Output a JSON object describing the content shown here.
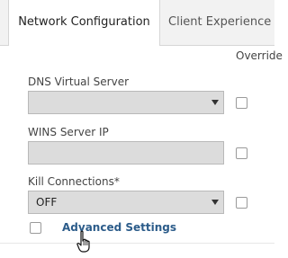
{
  "tabs": [
    {
      "label": "Network Configuration",
      "active": true
    },
    {
      "label": "Client Experience",
      "active": false
    }
  ],
  "override_header": "Override",
  "fields": {
    "dns": {
      "label": "DNS Virtual Server",
      "value": ""
    },
    "wins": {
      "label": "WINS Server IP",
      "value": ""
    },
    "kill": {
      "label": "Kill Connections*",
      "value": "OFF"
    }
  },
  "advanced": {
    "label": "Advanced Settings"
  },
  "icons": {
    "dropdown": "chevron-down-icon",
    "cursor": "hand-pointer-icon"
  }
}
